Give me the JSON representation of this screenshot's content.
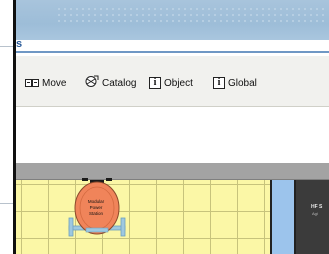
{
  "header": {
    "title_fragment": "s"
  },
  "toolbar": {
    "items": [
      {
        "label": "Move",
        "icon": "move-icon"
      },
      {
        "label": "Catalog",
        "icon": "catalog-icon"
      },
      {
        "label": "Object",
        "icon": "info-icon"
      },
      {
        "label": "Global",
        "icon": "info-icon"
      }
    ]
  },
  "floorplan": {
    "equipment": {
      "label_lines": [
        "Modular",
        "Power",
        "Station"
      ],
      "fill": "#f0845a",
      "frame": "#9ec8e0"
    },
    "rack": {
      "label": "HF S",
      "sublabel": "Agi"
    }
  },
  "colors": {
    "banner": "#a8c4dc",
    "toolbar_bg": "#f1f1ee",
    "grid_fill": "#fbf7a6",
    "column_blue": "#9cc4ec",
    "rack_dark": "#3b3b3b"
  }
}
